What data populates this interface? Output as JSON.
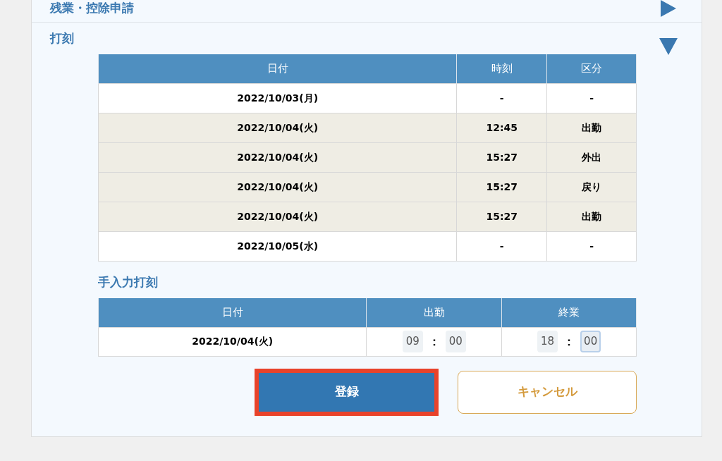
{
  "sections": [
    {
      "title": "残業・控除申請",
      "expanded": false
    },
    {
      "title": "打刻",
      "expanded": true
    }
  ],
  "punch_table": {
    "columns": [
      "日付",
      "時刻",
      "区分"
    ],
    "rows": [
      {
        "cells": [
          "2022/10/03(月)",
          "-",
          "-"
        ],
        "highlighted": false
      },
      {
        "cells": [
          "2022/10/04(火)",
          "12:45",
          "出勤"
        ],
        "highlighted": true
      },
      {
        "cells": [
          "2022/10/04(火)",
          "15:27",
          "外出"
        ],
        "highlighted": true
      },
      {
        "cells": [
          "2022/10/04(火)",
          "15:27",
          "戻り"
        ],
        "highlighted": true
      },
      {
        "cells": [
          "2022/10/04(火)",
          "15:27",
          "出勤"
        ],
        "highlighted": true
      },
      {
        "cells": [
          "2022/10/05(水)",
          "-",
          "-"
        ],
        "highlighted": false
      }
    ]
  },
  "manual_title": "手入力打刻",
  "manual_table": {
    "columns": [
      "日付",
      "出勤",
      "終業"
    ],
    "date": "2022/10/04(火)",
    "times": [
      {
        "hour": "09",
        "separator": "：",
        "minute": "00",
        "hour_focused": false,
        "minute_focused": false
      },
      {
        "hour": "18",
        "separator": "：",
        "minute": "00",
        "hour_focused": false,
        "minute_focused": true
      }
    ]
  },
  "buttons": [
    {
      "label": "登録",
      "kind": "primary",
      "focused": true
    },
    {
      "label": "キャンセル",
      "kind": "secondary",
      "focused": false
    }
  ]
}
